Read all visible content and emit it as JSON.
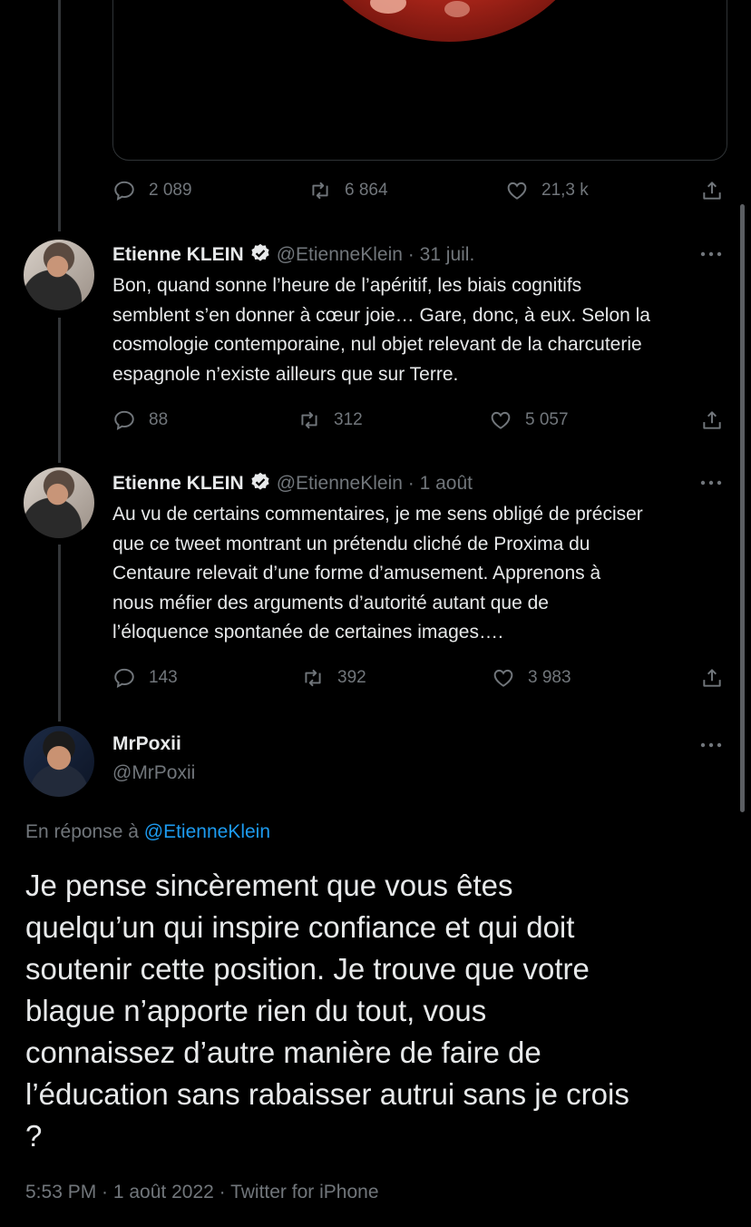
{
  "top_tweet": {
    "stats": {
      "replies": "2 089",
      "retweets": "6 864",
      "likes": "21,3 k"
    }
  },
  "tweets": [
    {
      "name": "Etienne KLEIN",
      "handle": "@EtienneKlein",
      "date": "· 31 juil.",
      "text_lines": [
        "Bon, quand sonne l’heure de l’apéritif, les biais cognitifs",
        "semblent s’en donner  à cœur joie… Gare, donc, à eux. Selon la",
        "cosmologie contemporaine, nul objet relevant de la charcuterie",
        "espagnole n’existe ailleurs que sur Terre."
      ],
      "stats": {
        "replies": "88",
        "retweets": "312",
        "likes": "5 057"
      }
    },
    {
      "name": "Etienne KLEIN",
      "handle": "@EtienneKlein",
      "date": "· 1 août",
      "text_lines": [
        "Au vu de certains commentaires, je me sens obligé de préciser",
        "que ce tweet montrant un prétendu cliché de Proxima du",
        "Centaure relevait d’une  forme d’amusement. Apprenons à",
        "nous méfier des arguments d’autorité autant que de",
        "l’éloquence spontanée de certaines images…."
      ],
      "stats": {
        "replies": "143",
        "retweets": "392",
        "likes": "3 983"
      }
    }
  ],
  "main_tweet": {
    "name": "MrPoxii",
    "handle": "@MrPoxii",
    "reply_prefix": "En réponse à ",
    "reply_handle": "@EtienneKlein",
    "text_lines": [
      "Je pense sincèrement que vous êtes",
      "quelqu’un qui inspire confiance et qui doit",
      "soutenir cette position. Je trouve que votre",
      "blague n’apporte rien du tout, vous",
      "connaissez d’autre manière de faire de",
      "l’éducation sans rabaisser autrui sans je crois",
      "?"
    ],
    "meta": "5:53 PM · 1 août 2022 · Twitter for iPhone"
  },
  "colors": {
    "background": "#000000",
    "text": "#e7e9ea",
    "muted": "#71767b",
    "link": "#1d9bf0",
    "verified": "#e7e9ea"
  },
  "icons": [
    "reply-icon",
    "retweet-icon",
    "like-icon",
    "share-icon",
    "verified-badge-icon",
    "more-icon"
  ]
}
